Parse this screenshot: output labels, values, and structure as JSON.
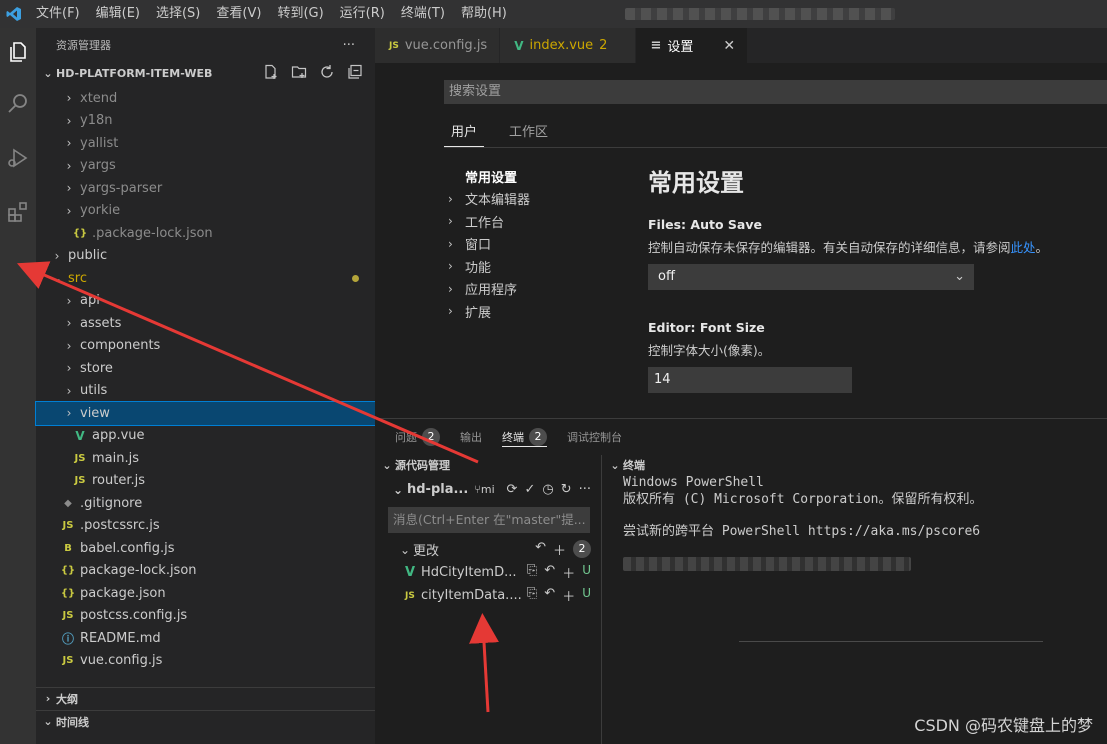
{
  "menubar": {
    "items": [
      "文件(F)",
      "编辑(E)",
      "选择(S)",
      "查看(V)",
      "转到(G)",
      "运行(R)",
      "终端(T)",
      "帮助(H)"
    ]
  },
  "activity": {
    "icons": [
      "files-icon",
      "search-icon",
      "run-debug-icon",
      "extensions-icon"
    ]
  },
  "explorer": {
    "header": "资源管理器",
    "more": "···",
    "folder": "HD-PLATFORM-ITEM-WEB",
    "rows": [
      {
        "label": "xtend",
        "chev": "›",
        "kind": "folder",
        "indent": 2,
        "dim": true
      },
      {
        "label": "y18n",
        "chev": "›",
        "kind": "folder",
        "indent": 2,
        "dim": true
      },
      {
        "label": "yallist",
        "chev": "›",
        "kind": "folder",
        "indent": 2,
        "dim": true
      },
      {
        "label": "yargs",
        "chev": "›",
        "kind": "folder",
        "indent": 2,
        "dim": true
      },
      {
        "label": "yargs-parser",
        "chev": "›",
        "kind": "folder",
        "indent": 2,
        "dim": true
      },
      {
        "label": "yorkie",
        "chev": "›",
        "kind": "folder",
        "indent": 2,
        "dim": true
      },
      {
        "label": ".package-lock.json",
        "icon": "{}",
        "kind": "json",
        "indent": 2,
        "dim": true
      },
      {
        "label": "public",
        "chev": "›",
        "kind": "folder",
        "indent": 1
      },
      {
        "label": "src",
        "chev": "⌄",
        "kind": "folder-open",
        "indent": 1,
        "modified": true
      },
      {
        "label": "api",
        "chev": "›",
        "kind": "folder",
        "indent": 2
      },
      {
        "label": "assets",
        "chev": "›",
        "kind": "folder",
        "indent": 2
      },
      {
        "label": "components",
        "chev": "›",
        "kind": "folder",
        "indent": 2
      },
      {
        "label": "store",
        "chev": "›",
        "kind": "folder",
        "indent": 2
      },
      {
        "label": "utils",
        "chev": "›",
        "kind": "folder",
        "indent": 2
      },
      {
        "label": "view",
        "chev": "›",
        "kind": "folder",
        "indent": 2,
        "selected": true
      },
      {
        "label": "app.vue",
        "icon": "V",
        "kind": "vue",
        "indent": 2
      },
      {
        "label": "main.js",
        "icon": "JS",
        "kind": "js",
        "indent": 2
      },
      {
        "label": "router.js",
        "icon": "JS",
        "kind": "js",
        "indent": 2
      },
      {
        "label": ".gitignore",
        "icon": "◆",
        "kind": "git",
        "indent": 1
      },
      {
        "label": ".postcssrc.js",
        "icon": "JS",
        "kind": "js",
        "indent": 1
      },
      {
        "label": "babel.config.js",
        "icon": "B",
        "kind": "js",
        "indent": 1
      },
      {
        "label": "package-lock.json",
        "icon": "{}",
        "kind": "json",
        "indent": 1
      },
      {
        "label": "package.json",
        "icon": "{}",
        "kind": "json",
        "indent": 1
      },
      {
        "label": "postcss.config.js",
        "icon": "JS",
        "kind": "js",
        "indent": 1
      },
      {
        "label": "README.md",
        "icon": "ⓘ",
        "kind": "info",
        "indent": 1
      },
      {
        "label": "vue.config.js",
        "icon": "JS",
        "kind": "js",
        "indent": 1
      }
    ],
    "outline": "大纲",
    "timeline": "时间线"
  },
  "tabs": [
    {
      "label": "vue.config.js",
      "icon": "JS",
      "kind": "js"
    },
    {
      "label": "index.vue",
      "icon": "V",
      "kind": "vue",
      "count": "2"
    },
    {
      "label": "设置",
      "icon": "≡",
      "kind": "settings",
      "active": true,
      "close": "✕"
    }
  ],
  "settings": {
    "search_placeholder": "搜索设置",
    "scope_user": "用户",
    "scope_workspace": "工作区",
    "toc": [
      "常用设置",
      "文本编辑器",
      "工作台",
      "窗口",
      "功能",
      "应用程序",
      "扩展"
    ],
    "title": "常用设置",
    "autosave": {
      "category": "Files: ",
      "name": "Auto Save",
      "desc": "控制自动保存未保存的编辑器。有关自动保存的详细信息，请参阅",
      "link": "此处",
      "desc_end": "。",
      "value": "off"
    },
    "fontsize": {
      "category": "Editor: ",
      "name": "Font Size",
      "desc": "控制字体大小(像素)。",
      "value": "14"
    }
  },
  "panel": {
    "tabs": [
      {
        "label": "问题",
        "badge": "2"
      },
      {
        "label": "输出"
      },
      {
        "label": "终端",
        "badge": "2",
        "active": true
      },
      {
        "label": "调试控制台"
      }
    ],
    "scm": {
      "header": "源代码管理",
      "repo": "hd-pla...",
      "branch": "mi",
      "message_placeholder": "消息(Ctrl+Enter 在\"master\"提...",
      "changes_label": "更改",
      "changes_count": "2",
      "files": [
        {
          "label": "HdCityItemD...",
          "icon": "V",
          "kind": "vue",
          "status": "U"
        },
        {
          "label": "cityItemData....",
          "icon": "JS",
          "kind": "js",
          "status": "U"
        }
      ]
    },
    "terminal": {
      "header": "终端",
      "lines": [
        "Windows PowerShell",
        "版权所有 (C) Microsoft Corporation。保留所有权利。",
        "",
        "尝试新的跨平台 PowerShell https://aka.ms/pscore6"
      ]
    }
  },
  "watermark": "CSDN @码农键盘上的梦",
  "colors": {
    "accent": "#007acc",
    "annotation_arrow": "#e53935",
    "selection": "#094771"
  }
}
